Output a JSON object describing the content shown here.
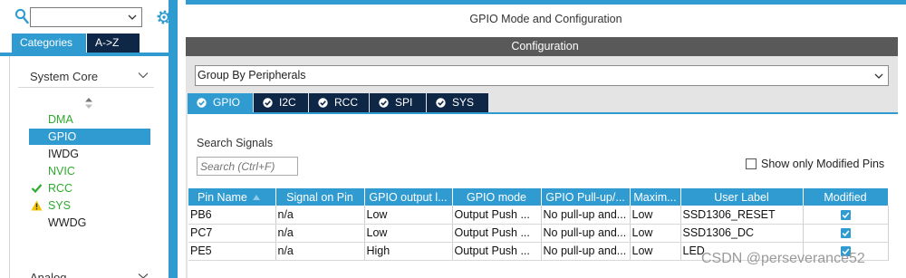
{
  "left_panel": {
    "search_value": "",
    "tabs": [
      {
        "label": "Categories",
        "active": true
      },
      {
        "label": "A->Z",
        "active": false
      }
    ],
    "category": "System Core",
    "peripherals": [
      {
        "label": "DMA",
        "status": "green"
      },
      {
        "label": "GPIO",
        "status": "selected"
      },
      {
        "label": "IWDG",
        "status": "black"
      },
      {
        "label": "NVIC",
        "status": "green"
      },
      {
        "label": "RCC",
        "status": "checked"
      },
      {
        "label": "SYS",
        "status": "warning"
      },
      {
        "label": "WWDG",
        "status": "black"
      }
    ],
    "next_category": "Analog"
  },
  "right_panel": {
    "title": "GPIO Mode and Configuration",
    "config_header": "Configuration",
    "group_select": "Group By Peripherals",
    "tabs": [
      {
        "label": "GPIO",
        "active": true
      },
      {
        "label": "I2C",
        "active": false
      },
      {
        "label": "RCC",
        "active": false
      },
      {
        "label": "SPI",
        "active": false
      },
      {
        "label": "SYS",
        "active": false
      }
    ],
    "search_label": "Search Signals",
    "search_placeholder": "Search (Ctrl+F)",
    "show_modified_label": "Show only Modified Pins",
    "show_modified_checked": false,
    "table": {
      "columns": [
        "Pin Name",
        "Signal on Pin",
        "GPIO output l...",
        "GPIO mode",
        "GPIO Pull-up/...",
        "Maxim...",
        "User Label",
        "Modified"
      ],
      "rows": [
        {
          "pin": "PB6",
          "signal": "n/a",
          "output": "Low",
          "mode": "Output Push ...",
          "pull": "No pull-up and...",
          "speed": "Low",
          "label": "SSD1306_RESET",
          "modified": true
        },
        {
          "pin": "PC7",
          "signal": "n/a",
          "output": "Low",
          "mode": "Output Push ...",
          "pull": "No pull-up and...",
          "speed": "Low",
          "label": "SSD1306_DC",
          "modified": true
        },
        {
          "pin": "PE5",
          "signal": "n/a",
          "output": "High",
          "mode": "Output Push ...",
          "pull": "No pull-up and...",
          "speed": "Low",
          "label": "LED",
          "modified": true
        }
      ]
    }
  },
  "watermark": "CSDN @perseverance52",
  "colors": {
    "accent": "#2f9bd1",
    "dark_tab": "#0f2747",
    "green_text": "#2eaa2e",
    "warning": "#f5c400"
  }
}
